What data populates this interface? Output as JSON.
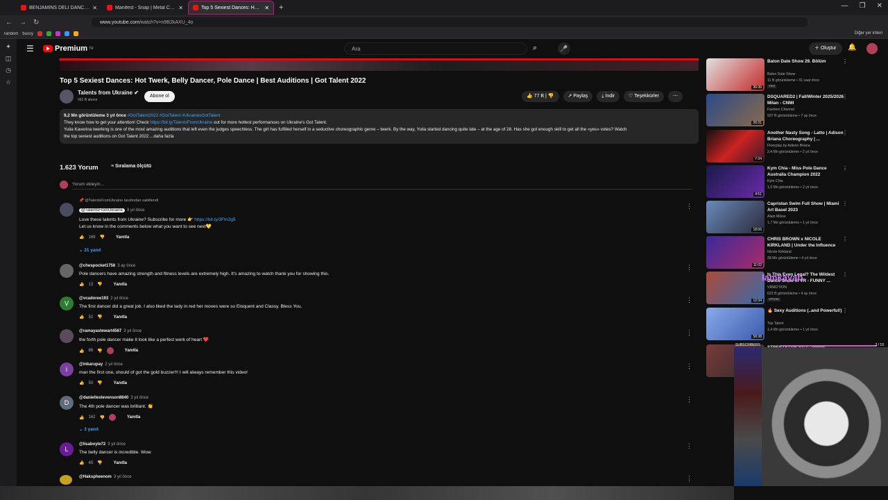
{
  "browser": {
    "tabs": [
      {
        "title": "BENJAMINS DELI DANCE TREN",
        "active": false
      },
      {
        "title": "Manifest - Snap | Metal Cover",
        "active": false
      },
      {
        "title": "Top 5 Sexiest Dances: Hot Twer",
        "active": true
      }
    ],
    "url_host": "www.youtube.com",
    "url_path": "/watch?v=n9B2kAXU_4o",
    "bookmarks": [
      "random",
      "bussy"
    ],
    "bookmarks_right": "Diğer yer imleri"
  },
  "yt": {
    "brand": "Premium",
    "brand_sup": "TR",
    "search_placeholder": "Ara",
    "create_label": "Oluştur"
  },
  "video": {
    "title": "Top 5 Sexiest Dances: Hot Twerk, Belly Dancer, Pole Dance | Best Auditions | Got Talent 2022",
    "channel": "Talents from Ukraine",
    "subs": "992 B abone",
    "subscribe": "Abone ol",
    "likes": "77 B",
    "share": "Paylaş",
    "download": "İndir",
    "thanks": "Teşekkürler",
    "desc_stats": "9,2 Mn görüntüleme  3 yıl önce",
    "desc_tags": "#GotTalent2022 #GotTalent #UkrainesGotTalent",
    "desc_line1_a": "They know how to get your attention! Check ",
    "desc_line1_link": "https://bit.ly/TalentsFromUkraine",
    "desc_line1_b": " out for more hottest performances on Ukraine's Got Talent.",
    "desc_line2": "Yulia Kaverina twerking is one of the most amazing auditions that left even the judges speechless. The girl has fulfilled herself in a seductive choreographic genre – twerk. By the way, Yulia started dancing quite late – at the age of 28. Has she got enough skill to get all the «yes» votes? Watch",
    "desc_line3": "the top sexiest auditions on Got Talent 2022  ...daha fazla"
  },
  "comments_section": {
    "count": "1.623 Yorum",
    "sort": "Sıralama ölçütü",
    "add_placeholder": "Yorum ekleyin...",
    "reply_label": "Yanıtla"
  },
  "comments": [
    {
      "pinned": "@TalentsFromUkraine tarafından sabitlendi",
      "author": "@TalentsFromUkraine",
      "time": "3 yıl önce",
      "text_a": "Love these talents from Ukraine? Subscribe for more 👉 ",
      "text_link": "https://bit.ly/3Ftn3g5",
      "text2": "Let us know in the comments below what you want to see next💛",
      "likes": "169",
      "replies": "21 yanıt",
      "color": "#4a4a60"
    },
    {
      "author": "@chespocket1756",
      "time": "3 ay önce",
      "text": "Pole dancers have amazing strength and fitness levels are extremely high. It's amazing to watch thank you for showing this.",
      "likes": "13",
      "color": "#666"
    },
    {
      "author": "@vcadoree193",
      "time": "2 yıl önce",
      "text": "The first dancer did a great job. I also liked the lady in red her moves were so Eloquent and Classy. Bless You.",
      "likes": "52",
      "initial": "V",
      "color": "#2e7d32"
    },
    {
      "author": "@ramayastewart4567",
      "time": "3 yıl önce",
      "text": "the forth pole dancer make  It look like a perfect  work of heart ❤️",
      "likes": "86",
      "color": "#5a4a5a"
    },
    {
      "author": "@inkarupay",
      "time": "2 yıl önce",
      "text": "man the first one, should of got the gold buzzer!!! I will always remember  this video!",
      "likes": "50",
      "initial": "i",
      "color": "#7b3fa0"
    },
    {
      "author": "@daniellestevenson8640",
      "time": "3 yıl önce",
      "text": "The 4th pole dancer was brilliant. 👏",
      "likes": "162",
      "initial": "D",
      "replies": "3 yanıt",
      "color": "#5f6b7a"
    },
    {
      "author": "@lisaboyle72",
      "time": "3 yıl önce",
      "text": "The belly dancer is incredible. Wow",
      "likes": "45",
      "initial": "L",
      "color": "#6a1b9a"
    },
    {
      "author": "@Hakspheenom",
      "time": "3 yıl önce",
      "text": "",
      "likes": "",
      "color": "#c8a020"
    }
  ],
  "recommendations": [
    {
      "title": "Balon Date Show 29. Bölüm",
      "channel": "Balon Date Show",
      "meta": "11 B görüntüleme • 31 saat önce",
      "badge": "Yeni",
      "dur": "36:36",
      "color": "#c42a2a"
    },
    {
      "title": "DSQUARED2 | Fall/Winter 2025/2026 Milan - CNMI",
      "channel": "Fashion Channel",
      "meta": "937 B görüntüleme • 7 ay önce",
      "dur": "26:31",
      "color": "#8a6a4a"
    },
    {
      "title": "Another Nasty Song - Latto | Adison Briana Choreography | ...",
      "channel": "Floorplay by Adison Briana",
      "meta": "2,4 Mn görüntüleme • 2 yıl önce",
      "dur": "7:34",
      "color": "#3a1a2a"
    },
    {
      "title": "Kym Chia - Miss Pole Dance Australia Champion 2022",
      "channel": "Kym Chia",
      "meta": "1,5 Mn görüntüleme • 2 yıl önce",
      "dur": "4:51",
      "color": "#2a1a5a"
    },
    {
      "title": "Capristan Swim Full Show | Miami Art Basel 2023",
      "channel": "Alain Moise",
      "meta": "1,7 Mn görüntüleme • 1 yıl önce",
      "dur": "18:06",
      "color": "#4a5a7a"
    },
    {
      "title": "CHRIS BROWN x NICOLE KIRKLAND | Under the Influence",
      "channel": "Nicole Kirkland",
      "meta": "28 Mn görüntüleme • 4 yıl önce",
      "dur": "11:02",
      "color": "#6a2a8a"
    },
    {
      "title": "Is This Even Legal? The Wildest Dance Show in VR - FUNNY ...",
      "channel": "VRMOTION",
      "meta": "622 B görüntüleme • 4 ay önce",
      "badge": "VR180",
      "dur": "12:34",
      "color": "#3a5a8a"
    },
    {
      "title": "🔥 Sexy Auditions (..and Powerful!)",
      "channel": "Top Talent",
      "meta": "1,4 Mn görüntüleme • 1 yıl önce",
      "dur": "58:38",
      "color": "#5a7aaa"
    },
    {
      "title": "STREETSTAR 2013 - Vogue",
      "channel": "",
      "meta": "",
      "dur": "",
      "color": "#7a3a3a"
    }
  ],
  "overlay": {
    "name": "Iamkayab",
    "subs_label": "SUBSCRIBERS",
    "subs_count": "3 / 10"
  }
}
